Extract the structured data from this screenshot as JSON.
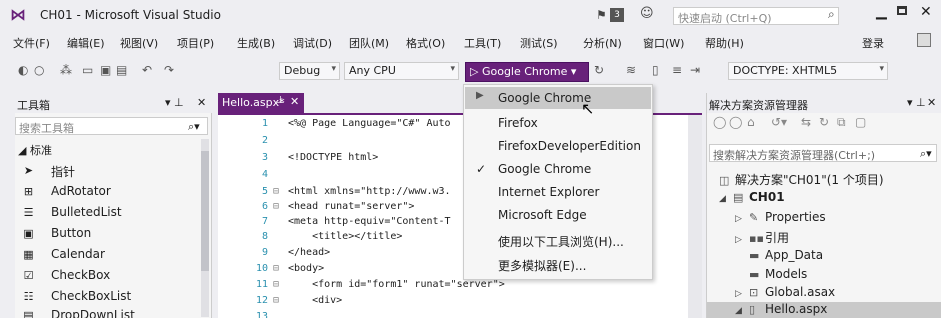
{
  "window": {
    "title": "CH01 - Microsoft Visual Studio",
    "notification_count": "3",
    "quick_launch_placeholder": "快速启动 (Ctrl+Q)",
    "login": "登录"
  },
  "menu": [
    "文件(F)",
    "编辑(E)",
    "视图(V)",
    "项目(P)",
    "生成(B)",
    "调试(D)",
    "团队(M)",
    "格式(O)",
    "工具(T)",
    "测试(S)",
    "分析(N)",
    "窗口(W)",
    "帮助(H)"
  ],
  "toolbar": {
    "config": "Debug",
    "platform": "Any CPU",
    "run_target": "▷ Google Chrome ▾",
    "doctype": "DOCTYPE: XHTML5"
  },
  "toolbox": {
    "title": "工具箱",
    "search_placeholder": "搜索工具箱",
    "group": "◢ 标准",
    "items": [
      {
        "label": "指针",
        "icon": "pointer-icon"
      },
      {
        "label": "AdRotator",
        "icon": "adrotator-icon"
      },
      {
        "label": "BulletedList",
        "icon": "bulletedlist-icon"
      },
      {
        "label": "Button",
        "icon": "button-icon"
      },
      {
        "label": "Calendar",
        "icon": "calendar-icon"
      },
      {
        "label": "CheckBox",
        "icon": "checkbox-icon"
      },
      {
        "label": "CheckBoxList",
        "icon": "checkboxlist-icon"
      },
      {
        "label": "DropDownList",
        "icon": "dropdownlist-icon"
      }
    ]
  },
  "editor": {
    "tab_label": "Hello.aspx*",
    "lines": [
      {
        "n": "1",
        "text": "<%@ Page Language=\"C#\" Auto"
      },
      {
        "n": "2",
        "text": ""
      },
      {
        "n": "3",
        "text": "<!DOCTYPE html>"
      },
      {
        "n": "4",
        "text": ""
      },
      {
        "n": "5",
        "text": "<html xmlns=\"http://www.w3."
      },
      {
        "n": "6",
        "text": "<head runat=\"server\">"
      },
      {
        "n": "7",
        "text": "<meta http-equiv=\"Content-T"
      },
      {
        "n": "8",
        "text": "    <title></title>"
      },
      {
        "n": "9",
        "text": "</head>"
      },
      {
        "n": "10",
        "text": "<body>"
      },
      {
        "n": "11",
        "text": "    <form id=\"form1\" runat=\"server\">"
      },
      {
        "n": "12",
        "text": "    <div>"
      },
      {
        "n": "13",
        "text": ""
      }
    ]
  },
  "run_menu": {
    "items": [
      "Google Chrome",
      "Firefox",
      "FirefoxDeveloperEdition",
      "Google Chrome",
      "Internet Explorer",
      "Microsoft Edge",
      "使用以下工具浏览(H)...",
      "更多模拟器(E)..."
    ],
    "checked_index": 3,
    "highlight_index": 0
  },
  "solution": {
    "title": "解决方案资源管理器",
    "search_placeholder": "搜索解决方案资源管理器(Ctrl+;)",
    "tree": [
      {
        "label": "解决方案\"CH01\"(1 个项目)",
        "icon": "solution-icon",
        "level": 0,
        "twisty": ""
      },
      {
        "label": "CH01",
        "icon": "project-icon",
        "level": 1,
        "twisty": "◢"
      },
      {
        "label": "Properties",
        "icon": "wrench-icon",
        "level": 2,
        "twisty": "▷"
      },
      {
        "label": "引用",
        "icon": "references-icon",
        "level": 2,
        "twisty": "▷"
      },
      {
        "label": "App_Data",
        "icon": "folder-icon",
        "level": 2,
        "twisty": ""
      },
      {
        "label": "Models",
        "icon": "folder-icon",
        "level": 2,
        "twisty": ""
      },
      {
        "label": "Global.asax",
        "icon": "file-icon",
        "level": 2,
        "twisty": "▷"
      },
      {
        "label": "Hello.aspx",
        "icon": "file-icon",
        "level": 2,
        "twisty": "◢"
      }
    ]
  }
}
